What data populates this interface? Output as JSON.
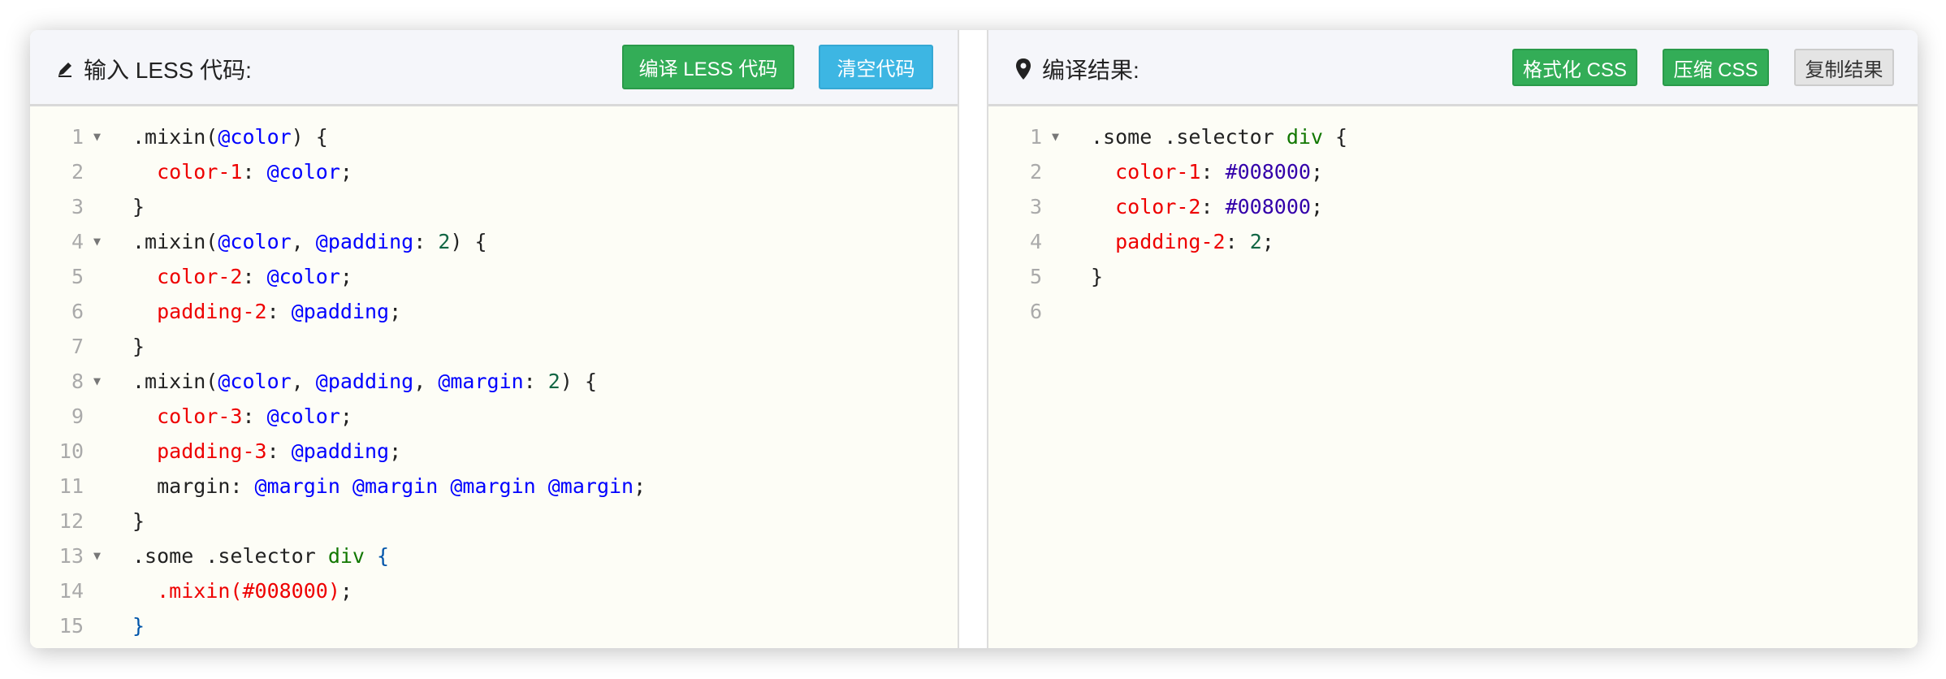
{
  "left": {
    "title": "输入 LESS 代码:",
    "icon": "pencil-icon",
    "buttons": {
      "compile": "编译 LESS 代码",
      "clear": "清空代码"
    },
    "lines": [
      {
        "n": "1",
        "fold": true,
        "t": [
          [
            ".mixin(",
            "def"
          ],
          [
            "@color",
            "var"
          ],
          [
            ") {",
            "def"
          ]
        ]
      },
      {
        "n": "2",
        "t": [
          [
            "  ",
            "def"
          ],
          [
            "color-1",
            "prop"
          ],
          [
            ": ",
            "def"
          ],
          [
            "@color",
            "var"
          ],
          [
            ";",
            "def"
          ]
        ]
      },
      {
        "n": "3",
        "t": [
          [
            "}",
            "def"
          ]
        ]
      },
      {
        "n": "4",
        "fold": true,
        "t": [
          [
            ".mixin(",
            "def"
          ],
          [
            "@color",
            "var"
          ],
          [
            ", ",
            "def"
          ],
          [
            "@padding",
            "var"
          ],
          [
            ": ",
            "def"
          ],
          [
            "2",
            "num"
          ],
          [
            ") {",
            "def"
          ]
        ]
      },
      {
        "n": "5",
        "t": [
          [
            "  ",
            "def"
          ],
          [
            "color-2",
            "prop"
          ],
          [
            ": ",
            "def"
          ],
          [
            "@color",
            "var"
          ],
          [
            ";",
            "def"
          ]
        ]
      },
      {
        "n": "6",
        "t": [
          [
            "  ",
            "def"
          ],
          [
            "padding-2",
            "prop"
          ],
          [
            ": ",
            "def"
          ],
          [
            "@padding",
            "var"
          ],
          [
            ";",
            "def"
          ]
        ]
      },
      {
        "n": "7",
        "t": [
          [
            "}",
            "def"
          ]
        ]
      },
      {
        "n": "8",
        "fold": true,
        "t": [
          [
            ".mixin(",
            "def"
          ],
          [
            "@color",
            "var"
          ],
          [
            ", ",
            "def"
          ],
          [
            "@padding",
            "var"
          ],
          [
            ", ",
            "def"
          ],
          [
            "@margin",
            "var"
          ],
          [
            ": ",
            "def"
          ],
          [
            "2",
            "num"
          ],
          [
            ") {",
            "def"
          ]
        ]
      },
      {
        "n": "9",
        "t": [
          [
            "  ",
            "def"
          ],
          [
            "color-3",
            "prop"
          ],
          [
            ": ",
            "def"
          ],
          [
            "@color",
            "var"
          ],
          [
            ";",
            "def"
          ]
        ]
      },
      {
        "n": "10",
        "t": [
          [
            "  ",
            "def"
          ],
          [
            "padding-3",
            "prop"
          ],
          [
            ": ",
            "def"
          ],
          [
            "@padding",
            "var"
          ],
          [
            ";",
            "def"
          ]
        ]
      },
      {
        "n": "11",
        "t": [
          [
            "  margin: ",
            "def"
          ],
          [
            "@margin @margin @margin @margin",
            "var"
          ],
          [
            ";",
            "def"
          ]
        ]
      },
      {
        "n": "12",
        "t": [
          [
            "}",
            "def"
          ]
        ]
      },
      {
        "n": "13",
        "fold": true,
        "t": [
          [
            ".some .selector ",
            "def"
          ],
          [
            "div",
            "tag"
          ],
          [
            " {",
            "br"
          ]
        ]
      },
      {
        "n": "14",
        "t": [
          [
            "  ",
            "def"
          ],
          [
            ".mixin(#008000)",
            "red"
          ],
          [
            ";",
            "def"
          ]
        ]
      },
      {
        "n": "15",
        "t": [
          [
            "}",
            "br"
          ]
        ]
      }
    ]
  },
  "right": {
    "title": "编译结果:",
    "icon": "map-pin-icon",
    "buttons": {
      "format": "格式化 CSS",
      "minify": "压缩 CSS",
      "copy": "复制结果"
    },
    "lines": [
      {
        "n": "1",
        "fold": true,
        "t": [
          [
            ".some .selector ",
            "def"
          ],
          [
            "div",
            "tag"
          ],
          [
            " {",
            "def"
          ]
        ]
      },
      {
        "n": "2",
        "t": [
          [
            "  ",
            "def"
          ],
          [
            "color-1",
            "prop"
          ],
          [
            ": ",
            "def"
          ],
          [
            "#008000",
            "hex"
          ],
          [
            ";",
            "def"
          ]
        ]
      },
      {
        "n": "3",
        "t": [
          [
            "  ",
            "def"
          ],
          [
            "color-2",
            "prop"
          ],
          [
            ": ",
            "def"
          ],
          [
            "#008000",
            "hex"
          ],
          [
            ";",
            "def"
          ]
        ]
      },
      {
        "n": "4",
        "t": [
          [
            "  ",
            "def"
          ],
          [
            "padding-2",
            "prop"
          ],
          [
            ": ",
            "def"
          ],
          [
            "2",
            "num"
          ],
          [
            ";",
            "def"
          ]
        ]
      },
      {
        "n": "5",
        "t": [
          [
            "}",
            "def"
          ]
        ]
      },
      {
        "n": "6",
        "t": []
      }
    ]
  }
}
